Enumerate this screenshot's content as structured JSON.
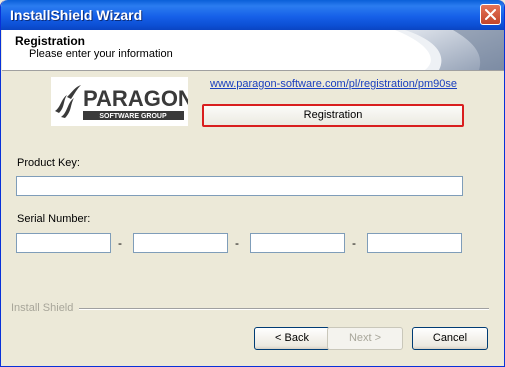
{
  "window": {
    "title": "InstallShield Wizard"
  },
  "header": {
    "title": "Registration",
    "subtitle": "Please enter your information"
  },
  "logo": {
    "brand": "PARAGON",
    "tagline": "SOFTWARE GROUP"
  },
  "registration": {
    "link_text": "www.paragon-software.com/pl/registration/pm90se",
    "button_label": "Registration"
  },
  "form": {
    "product_key_label": "Product Key:",
    "product_key_value": "",
    "serial_label": "Serial Number:",
    "serial_values": [
      "",
      "",
      "",
      ""
    ],
    "separator": "-"
  },
  "footer": {
    "group_label": "Install Shield",
    "back_label": "< Back",
    "next_label": "Next >",
    "cancel_label": "Cancel"
  },
  "colors": {
    "titlebar": "#0a5fd8",
    "dialog_bg": "#ece9d8",
    "highlight_border": "#d91e1e",
    "link": "#1a3fbf"
  }
}
